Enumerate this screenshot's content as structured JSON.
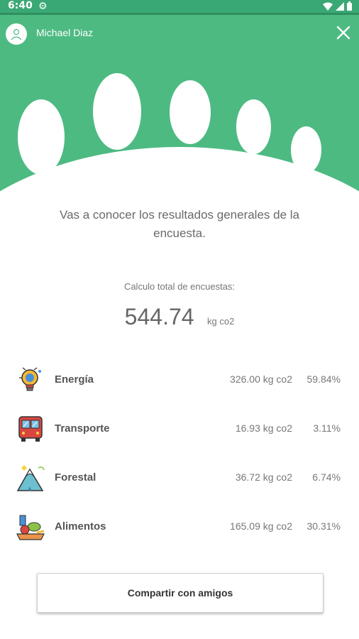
{
  "status_bar": {
    "time": "6:40"
  },
  "header": {
    "user_name": "Michael Diaz"
  },
  "intro": {
    "text": "Vas a conocer los resultados generales de la encuesta."
  },
  "summary": {
    "label": "Calculo total de encuestas:",
    "total": "544.74",
    "unit": "kg co2"
  },
  "categories": [
    {
      "name": "Energía",
      "amount": "326.00 kg co2",
      "percent": "59.84%",
      "icon": "lightbulb-icon"
    },
    {
      "name": "Transporte",
      "amount": "16.93 kg co2",
      "percent": "3.11%",
      "icon": "bus-icon"
    },
    {
      "name": "Forestal",
      "amount": "36.72 kg co2",
      "percent": "6.74%",
      "icon": "mountain-icon"
    },
    {
      "name": "Alimentos",
      "amount": "165.09 kg co2",
      "percent": "30.31%",
      "icon": "food-icon"
    }
  ],
  "actions": {
    "share_label": "Compartir con amigos"
  },
  "colors": {
    "brand_green": "#4dba82",
    "status_green": "#3aa874"
  }
}
